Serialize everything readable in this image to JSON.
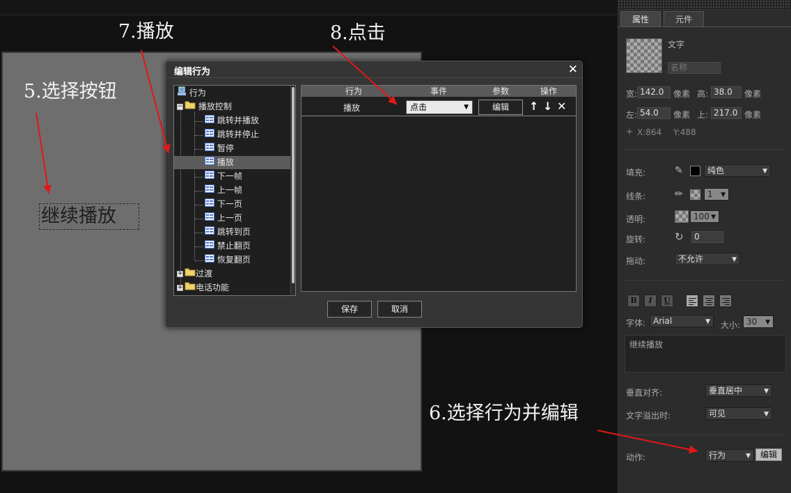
{
  "annotations": {
    "step5": "5.选择按钮",
    "step6": "6.选择行为并编辑",
    "step7": "7.播放",
    "step8": "8.点击"
  },
  "canvas": {
    "text_element": "继续播放"
  },
  "dialog": {
    "title": "编辑行为",
    "close_icon": "close-icon",
    "tree": {
      "root": "行为",
      "group_playback": "播放控制",
      "items": [
        "跳转并播放",
        "跳转并停止",
        "暂停",
        "播放",
        "下一帧",
        "上一帧",
        "下一页",
        "上一页",
        "跳转到页",
        "禁止翻页",
        "恢复翻页"
      ],
      "selected_item": "播放",
      "group_transition": "过渡",
      "group_phone": "电话功能"
    },
    "table": {
      "headers": {
        "action": "行为",
        "event": "事件",
        "param": "参数",
        "op": "操作"
      },
      "row": {
        "action": "播放",
        "event": "点击",
        "param_button": "编辑"
      },
      "op_icons": [
        "arrow-up-icon",
        "arrow-down-icon",
        "delete-icon"
      ]
    },
    "save_label": "保存",
    "cancel_label": "取消"
  },
  "panel": {
    "tabs": [
      "属性",
      "元件"
    ],
    "active_tab": "属性",
    "element_type": "文字",
    "name_placeholder": "名称",
    "width_label": "宽:",
    "width_value": "142.0",
    "unit": "像素",
    "height_label": "高:",
    "height_value": "38.0",
    "left_label": "左:",
    "left_value": "54.0",
    "top_label": "上:",
    "top_value": "217.0",
    "cursor_x": "X:864",
    "cursor_y": "Y:488",
    "fill_label": "填充:",
    "fill_color": "#000000",
    "fill_type": "纯色",
    "stroke_label": "线条:",
    "stroke_width": "1",
    "opacity_label": "透明:",
    "opacity_value": "100",
    "rotate_label": "旋转:",
    "rotate_value": "0",
    "drag_label": "拖动:",
    "drag_value": "不允许",
    "font_label": "字体:",
    "font_value": "Arial",
    "size_label": "大小:",
    "size_value": "30",
    "text_content": "继续播放",
    "valign_label": "垂直对齐:",
    "valign_value": "垂直居中",
    "overflow_label": "文字溢出时:",
    "overflow_value": "可见",
    "action_label": "动作:",
    "action_value": "行为",
    "action_edit": "编辑"
  }
}
